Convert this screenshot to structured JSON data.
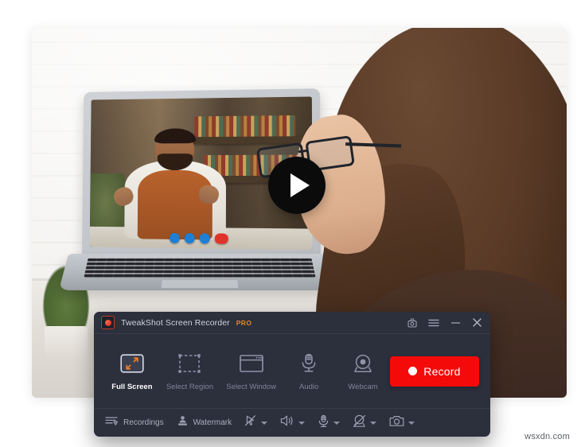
{
  "window": {
    "title": "TweakShot Screen Recorder",
    "badge": "PRO",
    "logo_icon": "app-logo-icon",
    "title_actions": [
      {
        "name": "screenshot-camera-icon",
        "label": "Screenshot"
      },
      {
        "name": "hamburger-menu-icon",
        "label": "Menu"
      },
      {
        "name": "minimize-icon",
        "label": "Minimize"
      },
      {
        "name": "close-icon",
        "label": "Close"
      }
    ]
  },
  "modes": [
    {
      "label": "Full Screen",
      "icon": "full-screen-icon",
      "active": true
    },
    {
      "label": "Select Region",
      "icon": "select-region-icon",
      "active": false
    },
    {
      "label": "Select Window",
      "icon": "select-window-icon",
      "active": false
    },
    {
      "label": "Audio",
      "icon": "microphone-icon",
      "active": false
    },
    {
      "label": "Webcam",
      "icon": "webcam-icon",
      "active": false
    }
  ],
  "record_button": {
    "label": "Record",
    "color": "#f50a0a",
    "indicator_icon": "record-dot-icon"
  },
  "bottom_bar": {
    "recordings": {
      "label": "Recordings",
      "icon": "recordings-list-icon"
    },
    "watermark": {
      "label": "Watermark",
      "icon": "watermark-stamp-icon"
    },
    "tools": [
      {
        "name": "cursor-disabled-icon",
        "has_dropdown": true
      },
      {
        "name": "speaker-icon",
        "has_dropdown": true
      },
      {
        "name": "microphone-icon",
        "has_dropdown": true
      },
      {
        "name": "webcam-disabled-icon",
        "has_dropdown": true
      },
      {
        "name": "camera-icon",
        "has_dropdown": true
      }
    ]
  },
  "photo": {
    "play_overlay_icon": "play-icon",
    "call_buttons": [
      {
        "name": "call-video-icon",
        "color": "#1e7fd4"
      },
      {
        "name": "call-mic-icon",
        "color": "#1e7fd4"
      },
      {
        "name": "call-volume-icon",
        "color": "#1e7fd4"
      },
      {
        "name": "call-hangup-icon",
        "color": "#e0342b"
      }
    ]
  },
  "watermark_text": "wsxdn.com"
}
